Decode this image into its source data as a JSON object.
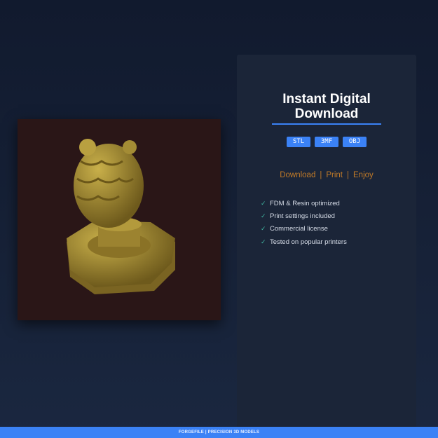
{
  "product": {
    "image": "golden statuette chess-piece model"
  },
  "panel": {
    "title_line1": "Instant Digital",
    "title_line2": "Download",
    "formats": [
      "STL",
      "3MF",
      "OBJ"
    ],
    "tagline": [
      "Download",
      "Print",
      "Enjoy"
    ],
    "features": [
      "FDM & Resin optimized",
      "Print settings included",
      "Commercial license",
      "Tested on popular printers"
    ]
  },
  "footer": {
    "brand": "FORGEFILE",
    "separator": "|",
    "subtitle": "PRECISION 3D MODELS"
  },
  "colors": {
    "accent": "#3b82f6",
    "tagline": "#c07a28",
    "check": "#3fb5a0"
  }
}
